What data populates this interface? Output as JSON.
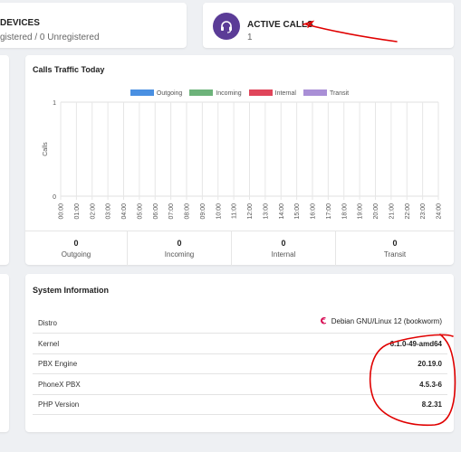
{
  "devices": {
    "title": "DEVICES",
    "subtitle": "gistered / 0 Unregistered"
  },
  "active_calls": {
    "title": "ACTIVE CALLS",
    "count": "1",
    "icon": "headset-icon",
    "icon_bg": "#5b3c97"
  },
  "traffic": {
    "title": "Calls Traffic Today",
    "legend": [
      {
        "label": "Outgoing",
        "color": "#4a90e2"
      },
      {
        "label": "Incoming",
        "color": "#6db37a"
      },
      {
        "label": "Internal",
        "color": "#e0455a"
      },
      {
        "label": "Transit",
        "color": "#a98fd6"
      }
    ],
    "summary": [
      {
        "value": "0",
        "label": "Outgoing"
      },
      {
        "value": "0",
        "label": "Incoming"
      },
      {
        "value": "0",
        "label": "Internal"
      },
      {
        "value": "0",
        "label": "Transit"
      }
    ]
  },
  "chart_data": {
    "type": "bar",
    "title": "",
    "xlabel": "",
    "ylabel": "Calls",
    "categories": [
      "00:00",
      "01:00",
      "02:00",
      "03:00",
      "04:00",
      "05:00",
      "06:00",
      "07:00",
      "08:00",
      "09:00",
      "10:00",
      "11:00",
      "12:00",
      "13:00",
      "14:00",
      "15:00",
      "16:00",
      "17:00",
      "18:00",
      "19:00",
      "20:00",
      "21:00",
      "22:00",
      "23:00",
      "24:00"
    ],
    "yticks": [
      "0",
      "1"
    ],
    "ylim": [
      0,
      1
    ],
    "grid": true,
    "legend_position": "top",
    "series": [
      {
        "name": "Outgoing",
        "color": "#4a90e2",
        "values": [
          0,
          0,
          0,
          0,
          0,
          0,
          0,
          0,
          0,
          0,
          0,
          0,
          0,
          0,
          0,
          0,
          0,
          0,
          0,
          0,
          0,
          0,
          0,
          0,
          0
        ]
      },
      {
        "name": "Incoming",
        "color": "#6db37a",
        "values": [
          0,
          0,
          0,
          0,
          0,
          0,
          0,
          0,
          0,
          0,
          0,
          0,
          0,
          0,
          0,
          0,
          0,
          0,
          0,
          0,
          0,
          0,
          0,
          0,
          0
        ]
      },
      {
        "name": "Internal",
        "color": "#e0455a",
        "values": [
          0,
          0,
          0,
          0,
          0,
          0,
          0,
          0,
          0,
          0,
          0,
          0,
          0,
          0,
          0,
          0,
          0,
          0,
          0,
          0,
          0,
          0,
          0,
          0,
          0
        ]
      },
      {
        "name": "Transit",
        "color": "#a98fd6",
        "values": [
          0,
          0,
          0,
          0,
          0,
          0,
          0,
          0,
          0,
          0,
          0,
          0,
          0,
          0,
          0,
          0,
          0,
          0,
          0,
          0,
          0,
          0,
          0,
          0,
          0
        ]
      }
    ]
  },
  "system": {
    "title": "System Information",
    "rows": [
      {
        "label": "Distro",
        "value": "Debian GNU/Linux 12 (bookworm)",
        "icon": "debian-swirl-icon"
      },
      {
        "label": "Kernel",
        "value": "6.1.0-49-amd64"
      },
      {
        "label": "PBX Engine",
        "value": "20.19.0"
      },
      {
        "label": "PhoneX PBX",
        "value": "4.5.3-6"
      },
      {
        "label": "PHP Version",
        "value": "8.2.31"
      }
    ]
  },
  "annotation_color": "#e00000"
}
